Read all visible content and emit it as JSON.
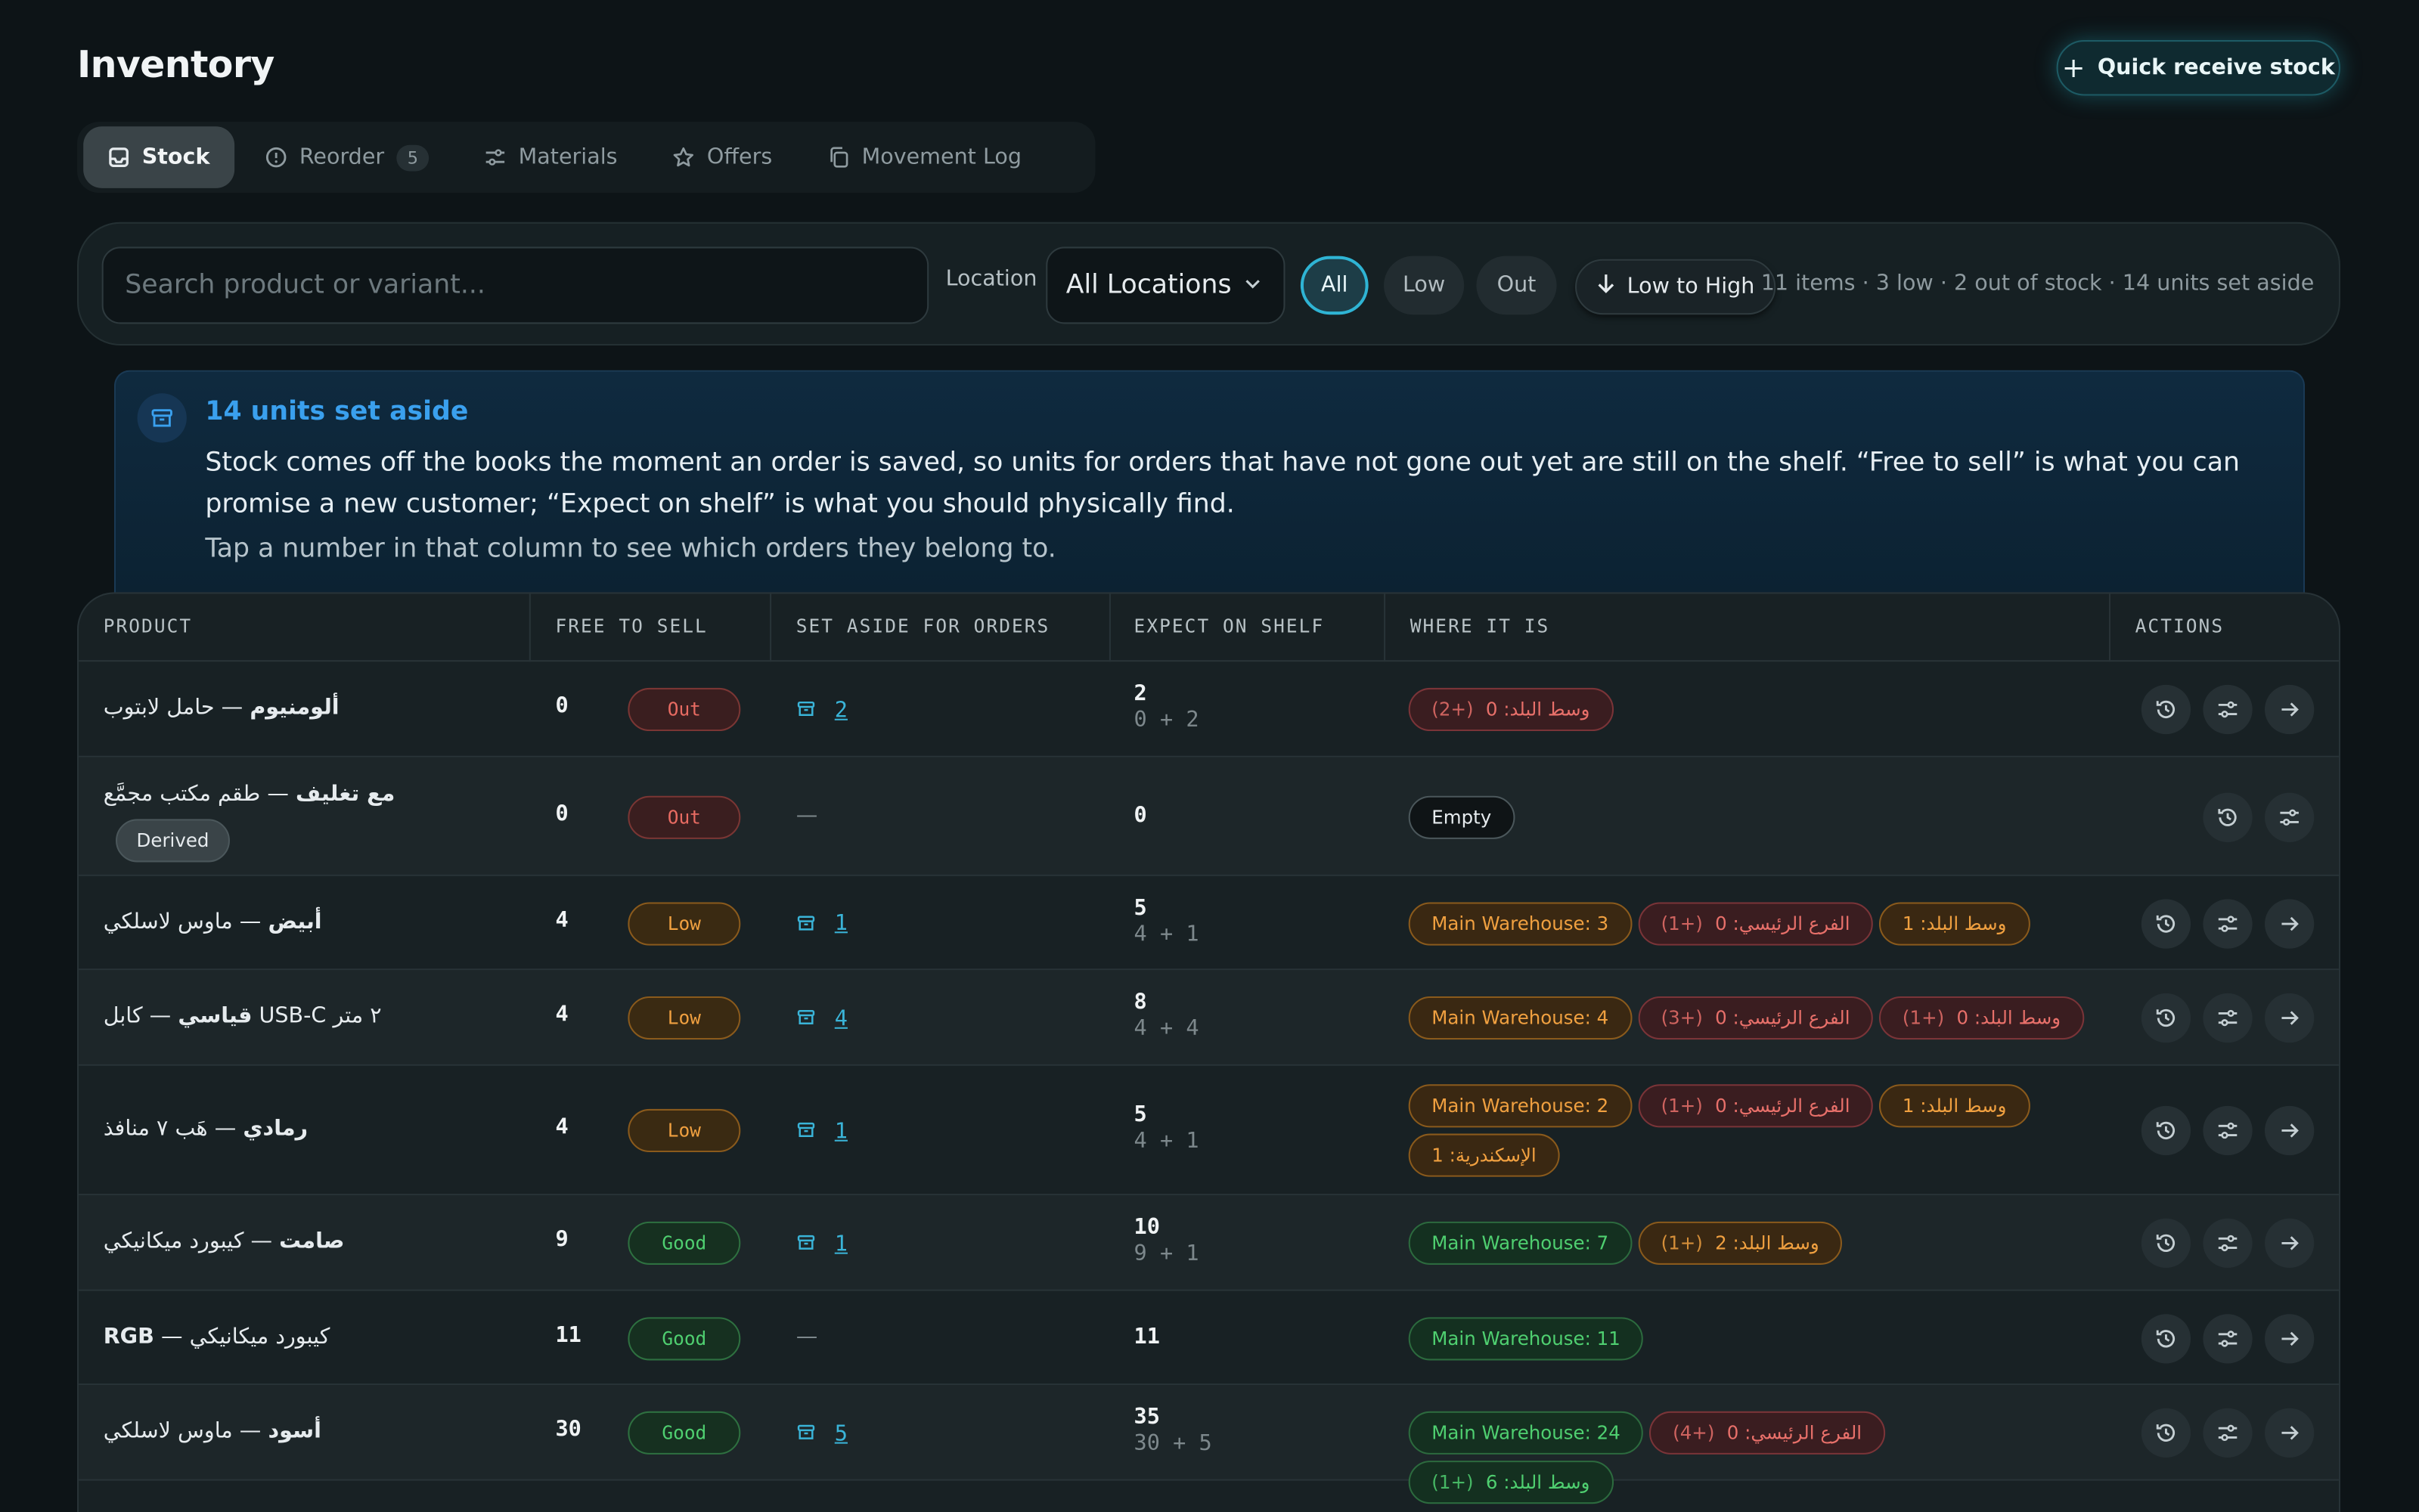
{
  "header": {
    "title": "Inventory",
    "quick_receive_label": "Quick receive stock"
  },
  "tabs": [
    {
      "label": "Stock",
      "active": true,
      "icon": "inbox-icon"
    },
    {
      "label": "Reorder",
      "count": "5",
      "icon": "alert-circle-icon"
    },
    {
      "label": "Materials",
      "icon": "sliders-icon"
    },
    {
      "label": "Offers",
      "icon": "star-icon"
    },
    {
      "label": "Movement Log",
      "icon": "copy-icon"
    }
  ],
  "filters": {
    "search_placeholder": "Search product or variant...",
    "location_label": "Location",
    "location_value": "All Locations",
    "stock_filters": [
      "All",
      "Low",
      "Out"
    ],
    "active_filter": "All",
    "sort_label": "Low to High",
    "summary": "11 items · 3 low · 2 out of stock · 14 units set aside"
  },
  "banner": {
    "title": "14 units set aside",
    "text": "Stock comes off the books the moment an order is saved, so units for orders that have not gone out yet are still on the shelf. “Free to sell” is what you can promise a new customer; “Expect on shelf” is what you should physically find.",
    "subtext": "Tap a number in that column to see which orders they belong to."
  },
  "table": {
    "columns": [
      "PRODUCT",
      "FREE TO SELL",
      "SET ASIDE FOR ORDERS",
      "EXPECT ON SHELF",
      "WHERE IT IS",
      "ACTIONS"
    ],
    "rows": [
      {
        "product_main": "حامل لابتوب",
        "sep": " — ",
        "variant": "ألومنيوم",
        "free": "0",
        "status": "Out",
        "aside": "2",
        "shelf_total": "2",
        "shelf_breakdown": "0 + 2",
        "locations": [
          {
            "label": "وسط البلد: 0",
            "extra": "(+2)",
            "tone": "red"
          }
        ]
      },
      {
        "product_main": "طقم مكتب مجمَّع",
        "sep": " — ",
        "variant": "مع تغليف",
        "derived": "Derived",
        "free": "0",
        "status": "Out",
        "aside": "—",
        "shelf_total": "0",
        "shelf_breakdown": "",
        "locations": [
          {
            "label": "Empty",
            "extra": "",
            "tone": "neutral"
          }
        ]
      },
      {
        "product_main": "ماوس لاسلكي",
        "sep": " — ",
        "variant": "أبيض",
        "free": "4",
        "status": "Low",
        "aside": "1",
        "shelf_total": "5",
        "shelf_breakdown": "4 + 1",
        "locations": [
          {
            "label": "Main Warehouse: 3",
            "extra": "",
            "tone": "orange"
          },
          {
            "label": "الفرع الرئيسي: 0",
            "extra": "(+1)",
            "tone": "red"
          },
          {
            "label": "وسط البلد: 1",
            "extra": "",
            "tone": "orange"
          }
        ]
      },
      {
        "product_main": "كابل USB-C ٢ متر",
        "sep": " — ",
        "variant": "قياسي",
        "free": "4",
        "status": "Low",
        "aside": "4",
        "shelf_total": "8",
        "shelf_breakdown": "4 + 4",
        "locations": [
          {
            "label": "Main Warehouse: 4",
            "extra": "",
            "tone": "orange"
          },
          {
            "label": "الفرع الرئيسي: 0",
            "extra": "(+3)",
            "tone": "red"
          },
          {
            "label": "وسط البلد: 0",
            "extra": "(+1)",
            "tone": "red"
          }
        ]
      },
      {
        "product_main": "هَب ٧ منافذ",
        "sep": " — ",
        "variant": "رمادي",
        "free": "4",
        "status": "Low",
        "aside": "1",
        "shelf_total": "5",
        "shelf_breakdown": "4 + 1",
        "locations": [
          {
            "label": "Main Warehouse: 2",
            "extra": "",
            "tone": "orange"
          },
          {
            "label": "الفرع الرئيسي: 0",
            "extra": "(+1)",
            "tone": "red"
          },
          {
            "label": "وسط البلد: 1",
            "extra": "",
            "tone": "orange"
          },
          {
            "label": "الإسكندرية: 1",
            "extra": "",
            "tone": "orange"
          }
        ]
      },
      {
        "product_main": "كيبورد ميكانيكي",
        "sep": " — ",
        "variant": "صامت",
        "free": "9",
        "status": "Good",
        "aside": "1",
        "shelf_total": "10",
        "shelf_breakdown": "9 + 1",
        "locations": [
          {
            "label": "Main Warehouse: 7",
            "extra": "",
            "tone": "green"
          },
          {
            "label": "وسط البلد: 2",
            "extra": "(+1)",
            "tone": "orange"
          }
        ]
      },
      {
        "product_main": "كيبورد ميكانيكي",
        "sep": " — ",
        "variant": "RGB",
        "free": "11",
        "status": "Good",
        "aside": "—",
        "shelf_total": "11",
        "shelf_breakdown": "",
        "locations": [
          {
            "label": "Main Warehouse: 11",
            "extra": "",
            "tone": "green"
          }
        ]
      },
      {
        "product_main": "ماوس لاسلكي",
        "sep": " — ",
        "variant": "أسود",
        "free": "30",
        "status": "Good",
        "aside": "5",
        "shelf_total": "35",
        "shelf_breakdown": "30 + 5",
        "locations": [
          {
            "label": "Main Warehouse: 24",
            "extra": "",
            "tone": "green"
          },
          {
            "label": "الفرع الرئيسي: 0",
            "extra": "(+4)",
            "tone": "red"
          },
          {
            "label": "وسط البلد: 6",
            "extra": "(+1)",
            "tone": "green"
          }
        ]
      }
    ]
  },
  "colors": {
    "accent": "#2fb4d4",
    "banner_title": "#3aa0ee",
    "out": "#e86b62",
    "low": "#f0a040",
    "good": "#4fcf70"
  }
}
